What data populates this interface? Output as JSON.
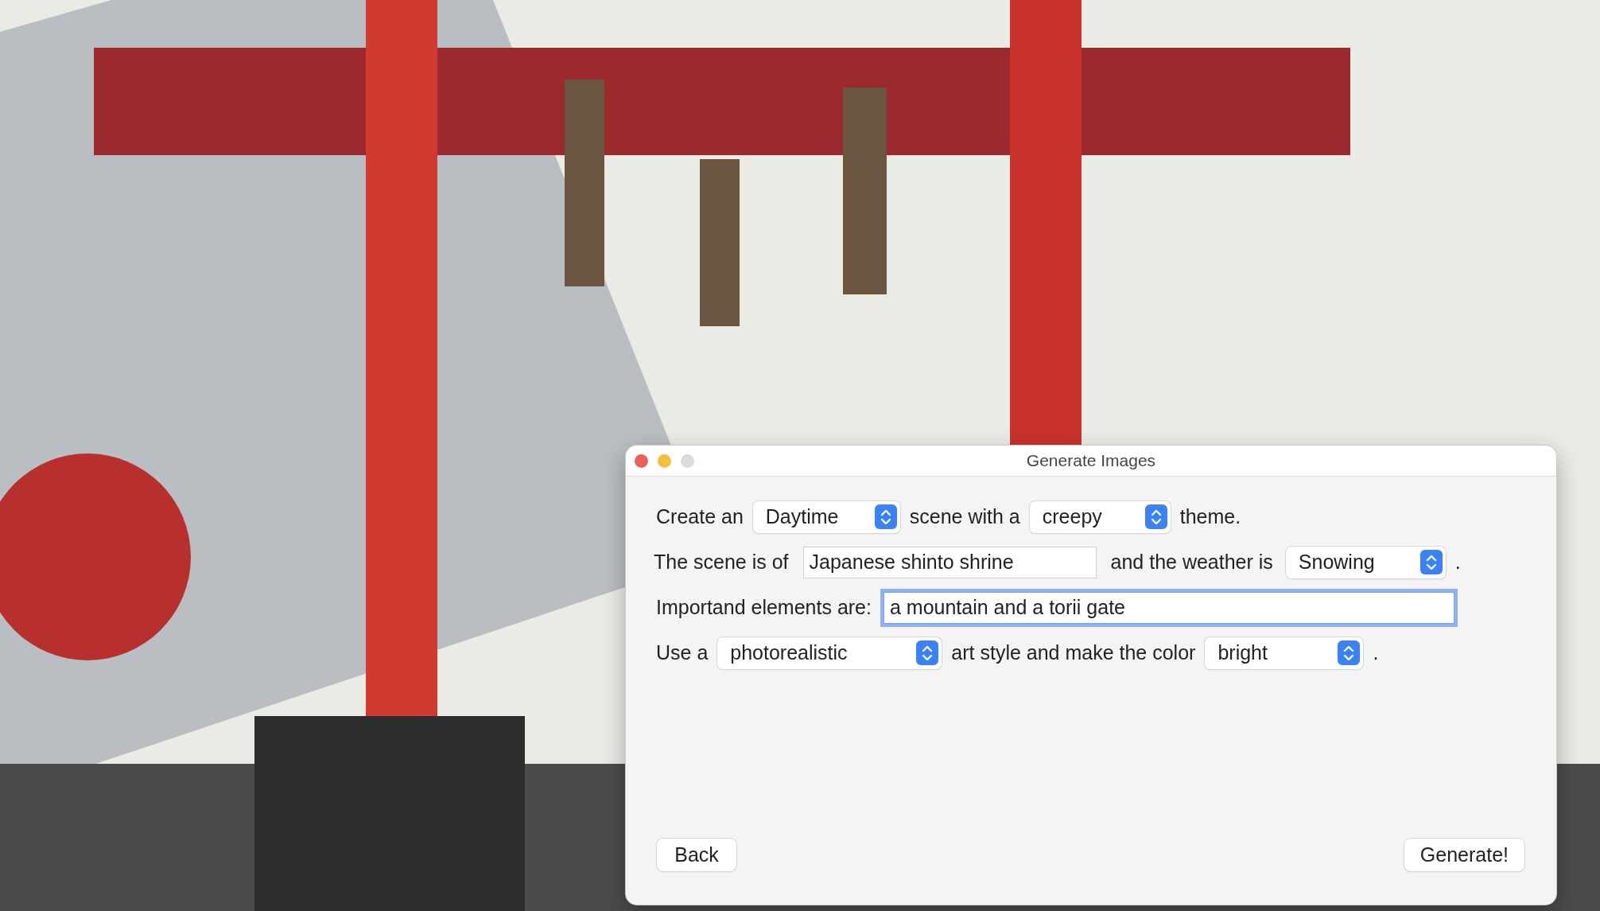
{
  "window": {
    "title": "Generate Images"
  },
  "rows": [
    {
      "items": [
        {
          "kind": "label",
          "text": "Create an"
        },
        {
          "kind": "popup",
          "value": "Daytime"
        },
        {
          "kind": "label",
          "text": "scene with a"
        },
        {
          "kind": "popup",
          "value": "creepy"
        },
        {
          "kind": "label",
          "text": "theme."
        }
      ]
    },
    {
      "items": [
        {
          "kind": "label",
          "text": "The scene is of"
        },
        {
          "kind": "field",
          "value": "Japanese shinto shrine",
          "focused": false
        },
        {
          "kind": "label",
          "text": "and the weather is"
        },
        {
          "kind": "popup",
          "value": "Snowing"
        },
        {
          "kind": "label",
          "text": "."
        }
      ]
    },
    {
      "items": [
        {
          "kind": "label",
          "text": "Importand elements are:"
        },
        {
          "kind": "field",
          "value": "a mountain and a torii gate",
          "focused": true
        }
      ]
    },
    {
      "items": [
        {
          "kind": "label",
          "text": "Use a"
        },
        {
          "kind": "popup",
          "value": "photorealistic"
        },
        {
          "kind": "label",
          "text": "art style and make the color"
        },
        {
          "kind": "popup",
          "value": "bright"
        },
        {
          "kind": "label",
          "text": "."
        }
      ]
    }
  ],
  "buttons": [
    {
      "label": "Back",
      "kind": "left"
    },
    {
      "label": "Generate!",
      "kind": "right"
    }
  ]
}
